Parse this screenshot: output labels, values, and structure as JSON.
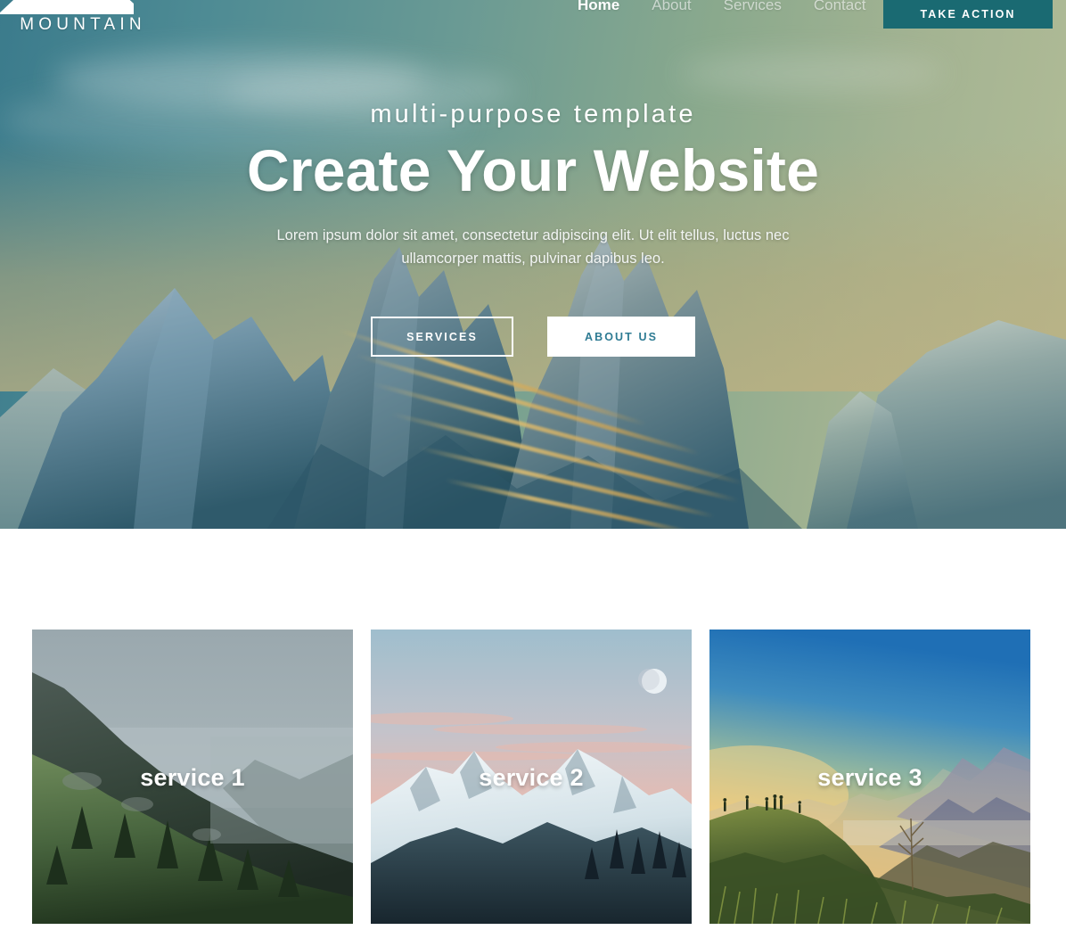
{
  "brand": {
    "name": "MOUNTAIN",
    "logo_icon": "mountain-peaks-icon"
  },
  "nav": {
    "links": [
      {
        "label": "Home",
        "active": true
      },
      {
        "label": "About",
        "active": false
      },
      {
        "label": "Services",
        "active": false
      },
      {
        "label": "Contact",
        "active": false
      }
    ],
    "cta_label": "TAKE ACTION",
    "cta_color": "#1a6a72"
  },
  "hero": {
    "eyebrow": "multi-purpose template",
    "headline": "Create Your Website",
    "subcopy": "Lorem ipsum dolor sit amet, consectetur adipiscing elit. Ut elit tellus, luctus nec ullamcorper mattis, pulvinar dapibus leo.",
    "buttons": [
      {
        "label": "SERVICES",
        "style": "outline"
      },
      {
        "label": "ABOUT US",
        "style": "solid"
      }
    ],
    "text_color": "#ffffff",
    "solid_button_text_color": "#2e7b93"
  },
  "services": {
    "cards": [
      {
        "title": "service 1",
        "scene": "foggy-green-ridge"
      },
      {
        "title": "service 2",
        "scene": "snowy-peaks-dusk-moon"
      },
      {
        "title": "service 3",
        "scene": "golden-sunrise-ridge"
      }
    ]
  }
}
